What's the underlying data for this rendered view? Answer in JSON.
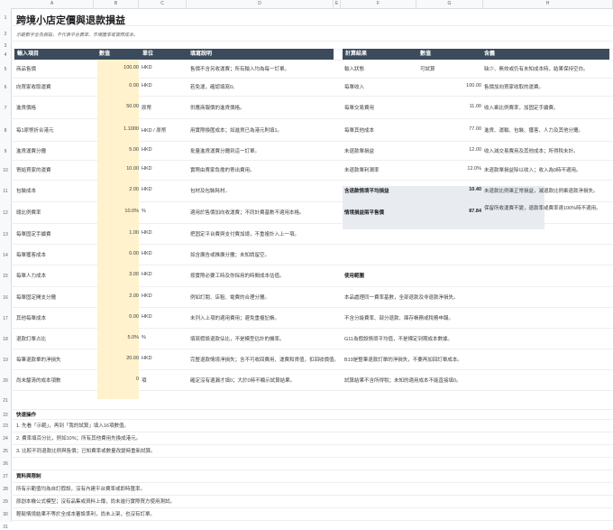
{
  "sheet": {
    "title": "跨境小店定價與退款損益",
    "subtitle": "示範數字全為假設，不代表平台費率、市場匯率或實際成本。",
    "columns": [
      "A",
      "B",
      "C",
      "D",
      "E",
      "F",
      "G",
      "H"
    ],
    "rows": [
      "1",
      "2",
      "3",
      "4",
      "5",
      "6",
      "7",
      "8",
      "9",
      "10",
      "11",
      "12",
      "13",
      "14",
      "15",
      "16",
      "17",
      "18",
      "19",
      "20",
      "21",
      "22",
      "23",
      "24",
      "25",
      "26",
      "27",
      "28",
      "29",
      "30",
      "31"
    ]
  },
  "input_table": {
    "headers": [
      "輸入項目",
      "數值",
      "單位",
      "填寫說明"
    ],
    "rows": [
      {
        "item": "商品售價",
        "value": "100.00",
        "unit": "HKD",
        "note": "售價不含另收運費；所有輸入均為每一訂單。"
      },
      {
        "item": "向買家收取運費",
        "value": "0.00",
        "unit": "HKD",
        "note": "若免運，確認填寫0。"
      },
      {
        "item": "進貨價格",
        "value": "50.00",
        "unit": "原幣",
        "note": "供應商報價的進貨價格。"
      },
      {
        "item": "每1原幣折合港元",
        "value": "1.1000",
        "unit": "HKD / 原幣",
        "note": "用實際換匯成本；如進貨已為港元則填1。"
      },
      {
        "item": "進貨運費分攤",
        "value": "5.00",
        "unit": "HKD",
        "note": "批量進貨運費分攤到這一訂單。"
      },
      {
        "item": "寄給買家的運費",
        "value": "10.00",
        "unit": "HKD",
        "note": "實際由賣家負擔的寄出費用。"
      },
      {
        "item": "包裝成本",
        "value": "2.00",
        "unit": "HKD",
        "note": "包材及包裝耗材。"
      },
      {
        "item": "總比例費率",
        "value": "10.0%",
        "unit": "%",
        "note": "適用於售價加向收運費；不同計費基數不適用本格。"
      },
      {
        "item": "每單固定手續費",
        "value": "1.00",
        "unit": "HKD",
        "note": "把固定平台費與支付費加總，不重複計入上一項。"
      },
      {
        "item": "每單獲客成本",
        "value": "0.00",
        "unit": "HKD",
        "note": "如含廣告或推廣分攤；未知請留空。"
      },
      {
        "item": "每單人力成本",
        "value": "3.00",
        "unit": "HKD",
        "note": "按實際必要工時及你採用的時間成本估值。"
      },
      {
        "item": "每單固定開支分攤",
        "value": "2.00",
        "unit": "HKD",
        "note": "例如訂閱、店租、電費的合理分攤。"
      },
      {
        "item": "其他每單成本",
        "value": "0.00",
        "unit": "HKD",
        "note": "未列入上項的適用費用；避免重複記帳。"
      },
      {
        "item": "退款訂單占比",
        "value": "5.0%",
        "unit": "%",
        "note": "填寫假設退款佔比，不是模型估計的機率。"
      },
      {
        "item": "每筆退款單的淨損失",
        "value": "20.00",
        "unit": "HKD",
        "note": "完整退款情境淨損失；含不可收回費用、運費和貨值，扣回收價值。"
      },
      {
        "item": "尚未釐清的成本項數",
        "value": "0",
        "unit": "項",
        "note": "確定沒有遺漏才填0；大於0時不顯示試算結果。"
      }
    ]
  },
  "result_table": {
    "headers": [
      "計算結果",
      "數值",
      "含義"
    ],
    "rows": [
      {
        "item": "輸入狀態",
        "value": "可試算",
        "meaning": "缺少、無效或仍有未知成本時，結果保持空白。"
      },
      {
        "item": "每單收入",
        "value": "100.00",
        "meaning": "售價加向買家收取的運費。"
      },
      {
        "item": "每單交易費用",
        "value": "11.00",
        "meaning": "收入乘比例費率，加固定手續費。"
      },
      {
        "item": "每單其他成本",
        "value": "77.00",
        "meaning": "進貨、運輸、包裝、獲客、人力及其他分攤。"
      },
      {
        "item": "未退款單損益",
        "value": "12.00",
        "meaning": "收入減交易費用及其他成本；所得稅未計。"
      },
      {
        "item": "未退款單利潤率",
        "value": "12.0%",
        "meaning": "未退款單損益除以收入；收入為0時不適用。"
      },
      {
        "item": "含退款情境平均損益",
        "value": "10.40",
        "meaning": "未退款比例乘正常損益，減退款比例乘退款淨損失。"
      },
      {
        "item": "情境損益兩平售價",
        "value": "87.84",
        "meaning": "保留所收運費不變，退款率或費率達100%時不適用。"
      }
    ]
  },
  "usage": {
    "title": "使用範圍",
    "lines": [
      "本品處理同一費率基數，全部退款及非退款淨損失。",
      "不含分級費率、部分退款、庫存帳務或稅務申報。",
      "G11為假設情境平均值，不是標定到期成本數據。",
      "B19是整筆退款訂單的淨損失，不要再加回訂單成本。",
      "試算結果不含所得稅；未知的適用成本不能直接填0。"
    ]
  },
  "quick_steps": {
    "title": "快速操作",
    "lines": [
      "1. 先看「示範」，再到「我的試算」填入16項數值。",
      "2. 費率填百分比，例如10%；所有其他費用先換成港元。",
      "3. 比較不同退款比例與售價；已知費率或數量改變時重新試算。"
    ]
  },
  "limits": {
    "title": "資料與限制",
    "lines": [
      "所有示範值均為自訂假設，沒有內建平台費率或即時匯率。",
      "原創本機公式模型；沒有品集或資料上傳，尚未進行實際買方使用測試。",
      "輕鬆情境結果不等於全成本審設準利，尚未上架，也沒有訂單。"
    ]
  },
  "colors": {
    "header_bg": "#3c4b5c",
    "input_bg": "#fff2cc",
    "result_bg": "#e8ecf1"
  }
}
